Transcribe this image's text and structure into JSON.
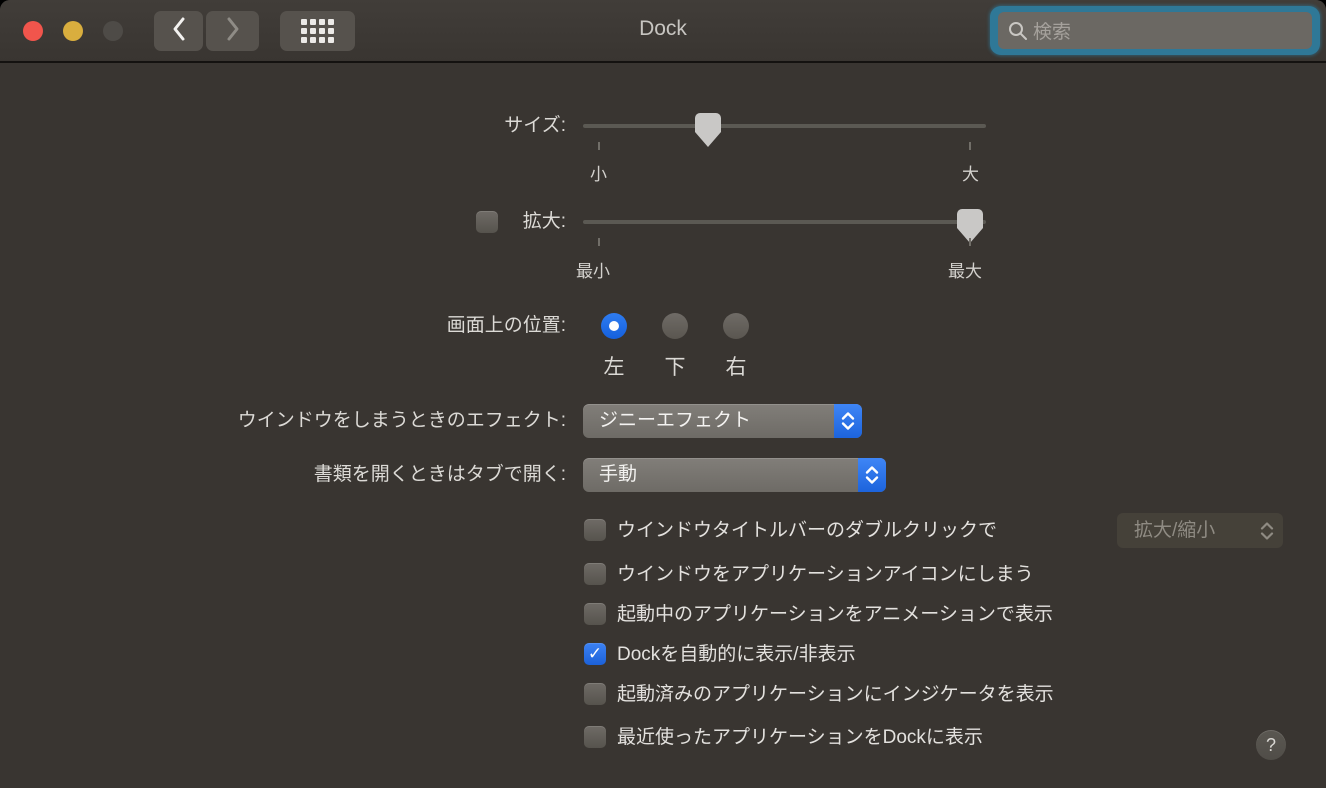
{
  "window": {
    "title": "Dock"
  },
  "toolbar": {
    "back_icon": "chevron-left",
    "forward_icon": "chevron-right",
    "show_all_icon": "grid",
    "search_placeholder": "検索"
  },
  "rows": {
    "size": {
      "label": "サイズ:",
      "min_label": "小",
      "max_label": "大",
      "value_percent": 31
    },
    "magnification": {
      "label": "拡大:",
      "checked": false,
      "min_label": "最小",
      "max_label": "最大",
      "value_percent": 96
    },
    "position": {
      "label": "画面上の位置:",
      "options": [
        {
          "label": "左",
          "selected": true
        },
        {
          "label": "下",
          "selected": false
        },
        {
          "label": "右",
          "selected": false
        }
      ]
    },
    "minimize_effect": {
      "label": "ウインドウをしまうときのエフェクト:",
      "value": "ジニーエフェクト"
    },
    "prefer_tabs": {
      "label": "書類を開くときはタブで開く:",
      "value": "手動"
    }
  },
  "checkboxes": [
    {
      "label": "ウインドウタイトルバーのダブルクリックで",
      "checked": false,
      "extra_dropdown_value": "拡大/縮小",
      "extra_dropdown_disabled": true
    },
    {
      "label": "ウインドウをアプリケーションアイコンにしまう",
      "checked": false
    },
    {
      "label": "起動中のアプリケーションをアニメーションで表示",
      "checked": false
    },
    {
      "label": "Dockを自動的に表示/非表示",
      "checked": true
    },
    {
      "label": "起動済みのアプリケーションにインジケータを表示",
      "checked": false
    },
    {
      "label": "最近使ったアプリケーションをDockに表示",
      "checked": false
    }
  ],
  "check_glyph": "✓",
  "help_label": "?",
  "colors": {
    "accent": "#2270e9",
    "focus_ring": "#2f7897",
    "window_bg": "#393531"
  }
}
